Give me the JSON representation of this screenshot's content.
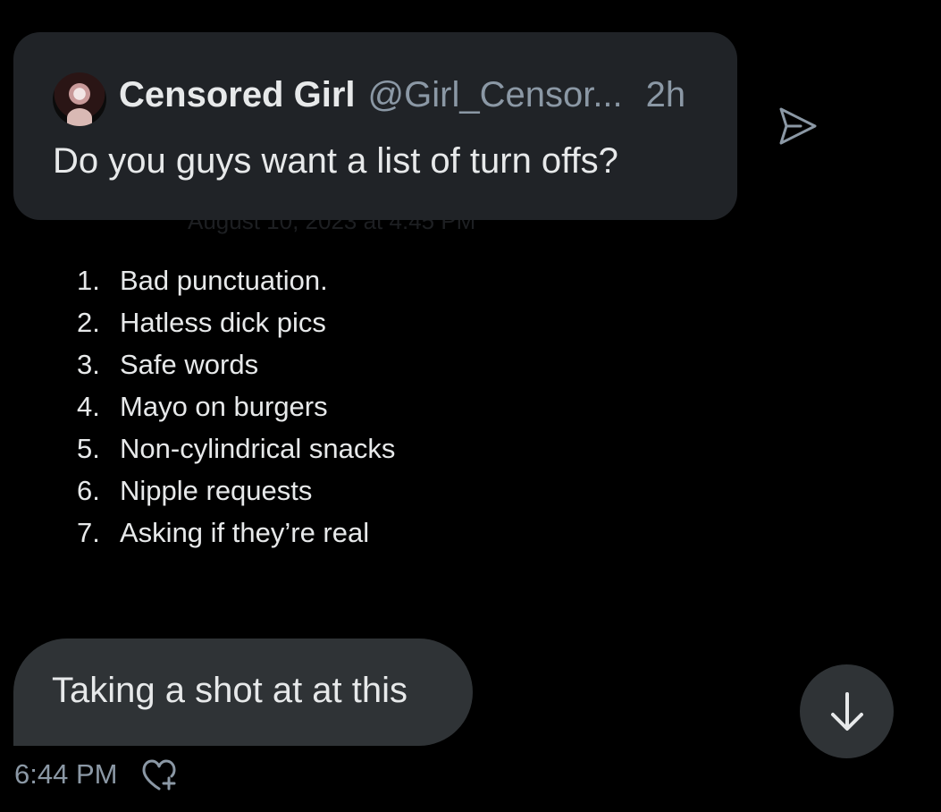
{
  "quoted_tweet": {
    "author_name": "Censored Girl",
    "author_handle": "@Girl_Censor...",
    "time": "2h",
    "text": "Do you guys want a list of turn offs?",
    "partial_text": "August 10, 2023 at 4:45 PM",
    "list": [
      {
        "number": "1.",
        "text": "Bad punctuation."
      },
      {
        "number": "2.",
        "text": "Hatless dick pics"
      },
      {
        "number": "3.",
        "text": "Safe words"
      },
      {
        "number": "4.",
        "text": "Mayo on burgers"
      },
      {
        "number": "5.",
        "text": "Non-cylindrical snacks"
      },
      {
        "number": "6.",
        "text": "Nipple requests"
      },
      {
        "number": "7.",
        "text": "Asking if they’re real"
      }
    ]
  },
  "message": {
    "text": "Taking a shot at at this",
    "timestamp": "6:44 PM"
  },
  "icons": {
    "share": "send-icon",
    "react": "heart-plus-icon",
    "scroll": "arrow-down-icon",
    "avatar": "avatar"
  },
  "colors": {
    "background": "#000000",
    "card": "#202327",
    "bubble": "#2f3336",
    "text_primary": "#e7e9ea",
    "text_secondary": "#8b98a5"
  }
}
